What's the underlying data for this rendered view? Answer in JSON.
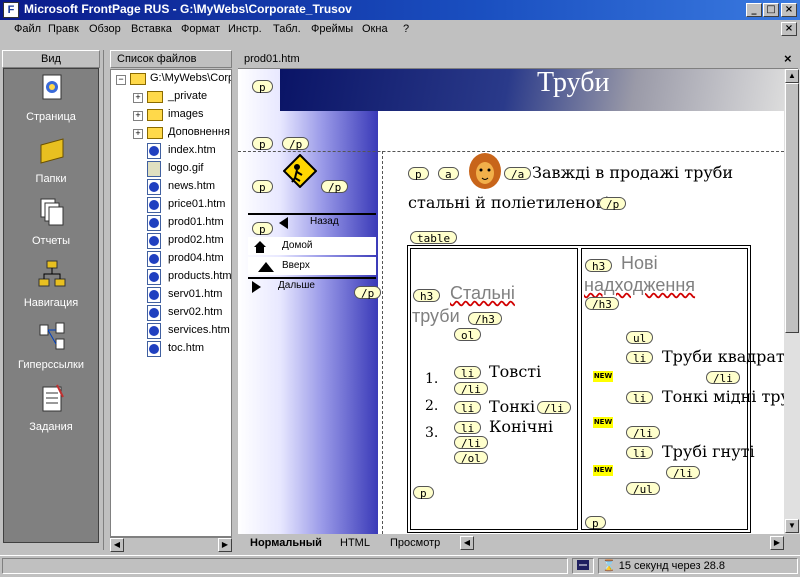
{
  "window": {
    "title": "Microsoft FrontPage RUS - G:\\MyWebs\\Corporate_Trusov"
  },
  "menu": [
    "Файл",
    "Правк",
    "Обзор",
    "Вставка",
    "Формат",
    "Инстр.",
    "Табл.",
    "Фреймы",
    "Окна",
    "?"
  ],
  "views": {
    "header": "Вид",
    "items": [
      {
        "label": "Страница",
        "icon": "page-view-icon"
      },
      {
        "label": "Папки",
        "icon": "folders-view-icon"
      },
      {
        "label": "Отчеты",
        "icon": "reports-view-icon"
      },
      {
        "label": "Навигация",
        "icon": "navigation-view-icon"
      },
      {
        "label": "Гиперссылки",
        "icon": "hyperlinks-view-icon"
      },
      {
        "label": "Задания",
        "icon": "tasks-view-icon"
      }
    ]
  },
  "files": {
    "header": "Список файлов",
    "root": "G:\\MyWebs\\Corp",
    "folders": [
      "_private",
      "images",
      "Доповнення"
    ],
    "items": [
      "index.htm",
      "logo.gif",
      "news.htm",
      "price01.htm",
      "prod01.htm",
      "prod02.htm",
      "prod04.htm",
      "products.htm",
      "serv01.htm",
      "serv02.htm",
      "services.htm",
      "toc.htm"
    ]
  },
  "editor": {
    "tab": "prod01.htm",
    "banner_title": "Труби",
    "intro_line1": "Завжді в продажі труби",
    "intro_line2": "стальні й поліетиленові",
    "nav": {
      "back": "Назад",
      "home": "Домой",
      "up": "Вверх",
      "next": "Дальше"
    },
    "col1": {
      "heading_line1": "Стальні",
      "heading_line2": "труби",
      "items": [
        "Товсті",
        "Тонкі",
        "Конічні"
      ],
      "numbers": [
        "1.",
        "2.",
        "3."
      ]
    },
    "col2": {
      "heading_line1": "Нові",
      "heading_line2": "надходження",
      "items": [
        "Труби квадратні",
        "Тонкі мідні труби",
        "Трубі гнуті"
      ],
      "badge": "NEW"
    },
    "tags": {
      "p": "p",
      "p_end": "/p",
      "a": "a",
      "a_end": "/a",
      "table": "table",
      "h3": "h3",
      "h3_end": "/h3",
      "ol": "ol",
      "ol_end": "/ol",
      "ul": "ul",
      "ul_end": "/ul",
      "li": "li",
      "li_end": "/li"
    }
  },
  "view_tabs": [
    "Нормальный",
    "HTML",
    "Просмотр"
  ],
  "status": {
    "time": "15 секунд через 28.8"
  }
}
